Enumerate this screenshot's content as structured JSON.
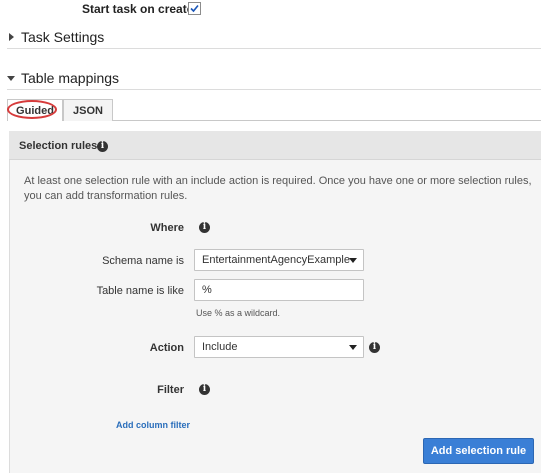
{
  "start_task": {
    "label": "Start task on create",
    "checked": true
  },
  "task_settings": {
    "title": "Task Settings",
    "expanded": false
  },
  "table_mappings": {
    "title": "Table mappings",
    "expanded": true,
    "tabs": [
      {
        "label": "Guided",
        "active": true
      },
      {
        "label": "JSON",
        "active": false
      }
    ]
  },
  "selection_rules": {
    "title": "Selection rules",
    "description": "At least one selection rule with an include action is required. Once you have one or more selection rules, you can add transformation rules.",
    "where_label": "Where",
    "schema_label": "Schema name is",
    "schema_value": "EntertainmentAgencyExample",
    "table_label": "Table name is like",
    "table_value": "%",
    "table_hint": "Use % as a wildcard.",
    "action_label": "Action",
    "action_value": "Include",
    "filter_label": "Filter",
    "add_column_filter": "Add column filter",
    "add_rule_button": "Add selection rule"
  },
  "colors": {
    "primary_button": "#3a7fd6",
    "link": "#2a6ebb",
    "highlight_oval": "#d63b3b"
  },
  "icons": {
    "checkbox": "check-icon",
    "collapsed": "caret-right-icon",
    "expanded": "caret-down-icon",
    "info": "info-icon",
    "dropdown": "chevron-down-icon"
  }
}
